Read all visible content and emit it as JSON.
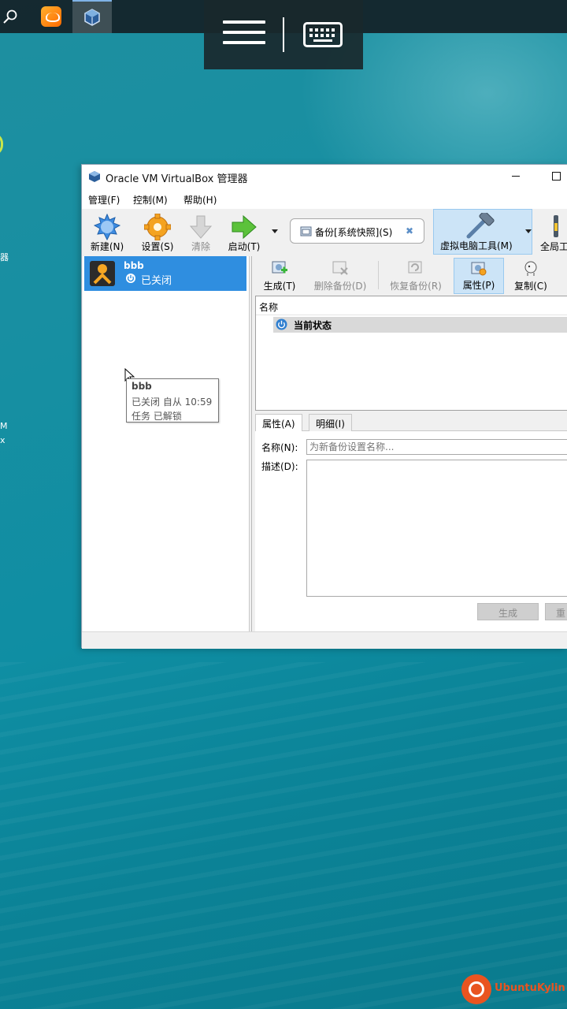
{
  "window": {
    "title": "Oracle VM VirtualBox 管理器"
  },
  "menu": [
    "管理(F)",
    "控制(M)",
    "帮助(H)"
  ],
  "toolbar": {
    "new": "新建(N)",
    "settings": "设置(S)",
    "discard": "清除",
    "start": "启动(T)",
    "snapshot_label": "备份[系统快照](S)",
    "machine_tools": "虚拟电脑工具(M)",
    "global_tools": "全局工"
  },
  "vm": {
    "name": "bbb",
    "state": "已关闭",
    "tooltip": {
      "name": "bbb",
      "line1": "已关闭 自从 10:59",
      "line2": "任务 已解锁"
    }
  },
  "snapshot_toolbar": {
    "take": "生成(T)",
    "delete": "删除备份(D)",
    "restore": "恢复备份(R)",
    "properties": "属性(P)",
    "clone": "复制(C)"
  },
  "snapshot_tree": {
    "header": "名称",
    "current_state": "当前状态"
  },
  "details": {
    "tab_attributes": "属性(A)",
    "tab_information": "明细(I)",
    "name_label": "名称(N):",
    "name_placeholder": "为新备份设置名称...",
    "desc_label": "描述(D):",
    "create_button": "生成",
    "reset_button": "重"
  },
  "desktop": {
    "frag_1": "器",
    "frag_2": "M",
    "frag_3": "x"
  },
  "watermark": "UbuntuKylin",
  "colors": {
    "selection": "#2f8ee0",
    "active_tool": "#cce4f7",
    "watermark": "#e95420"
  }
}
